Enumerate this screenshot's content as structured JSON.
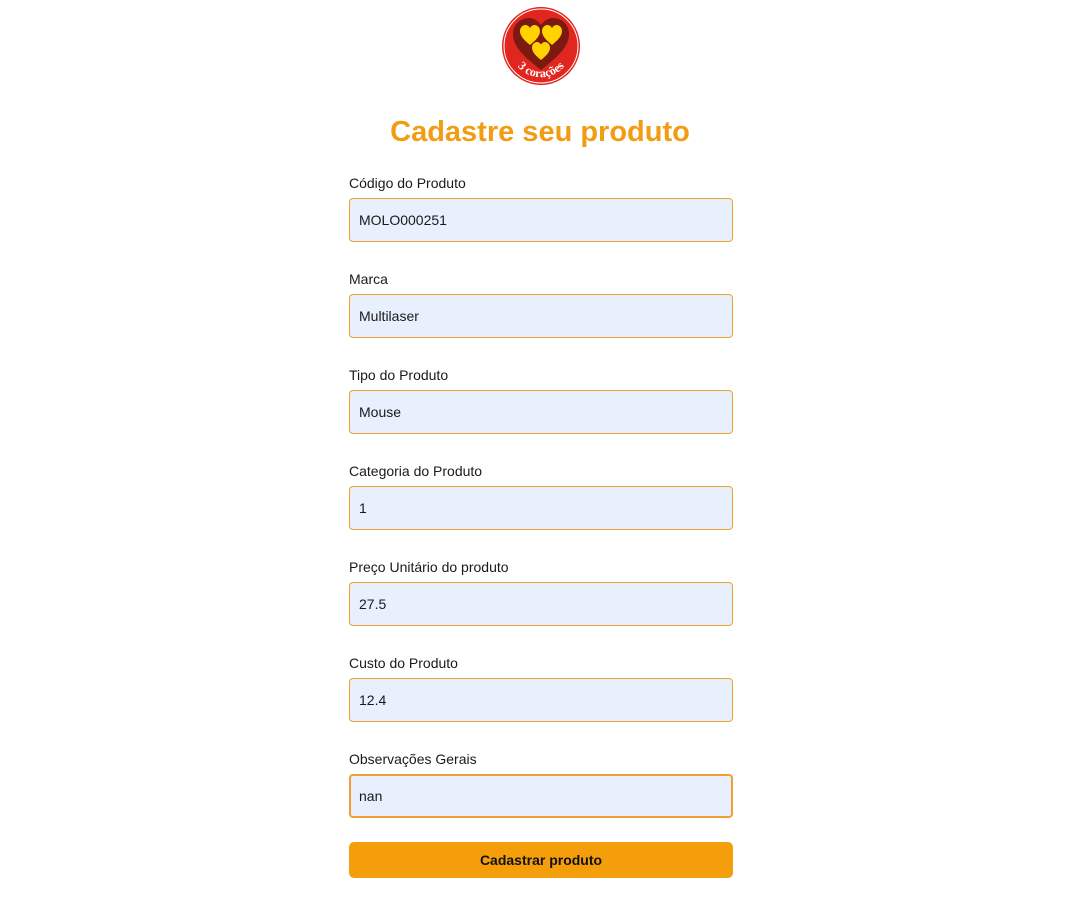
{
  "logo": {
    "text": "3 corações",
    "colors": {
      "ring": "#e0261e",
      "heart_outer": "#7a1a10",
      "heart_inner": "#ffd200"
    }
  },
  "header": {
    "title": "Cadastre seu produto"
  },
  "form": {
    "fields": [
      {
        "label": "Código do Produto",
        "value": "MOLO000251"
      },
      {
        "label": "Marca",
        "value": "Multilaser"
      },
      {
        "label": "Tipo do Produto",
        "value": "Mouse"
      },
      {
        "label": "Categoria do Produto",
        "value": "1"
      },
      {
        "label": "Preço Unitário do produto",
        "value": "27.5"
      },
      {
        "label": "Custo do Produto",
        "value": "12.4"
      },
      {
        "label": "Observações Gerais",
        "value": "nan"
      }
    ],
    "submit_label": "Cadastrar produto"
  },
  "colors": {
    "accent": "#f29c14",
    "button": "#f59e0b",
    "input_bg": "#e8f0fe",
    "input_border": "#f0a030"
  }
}
